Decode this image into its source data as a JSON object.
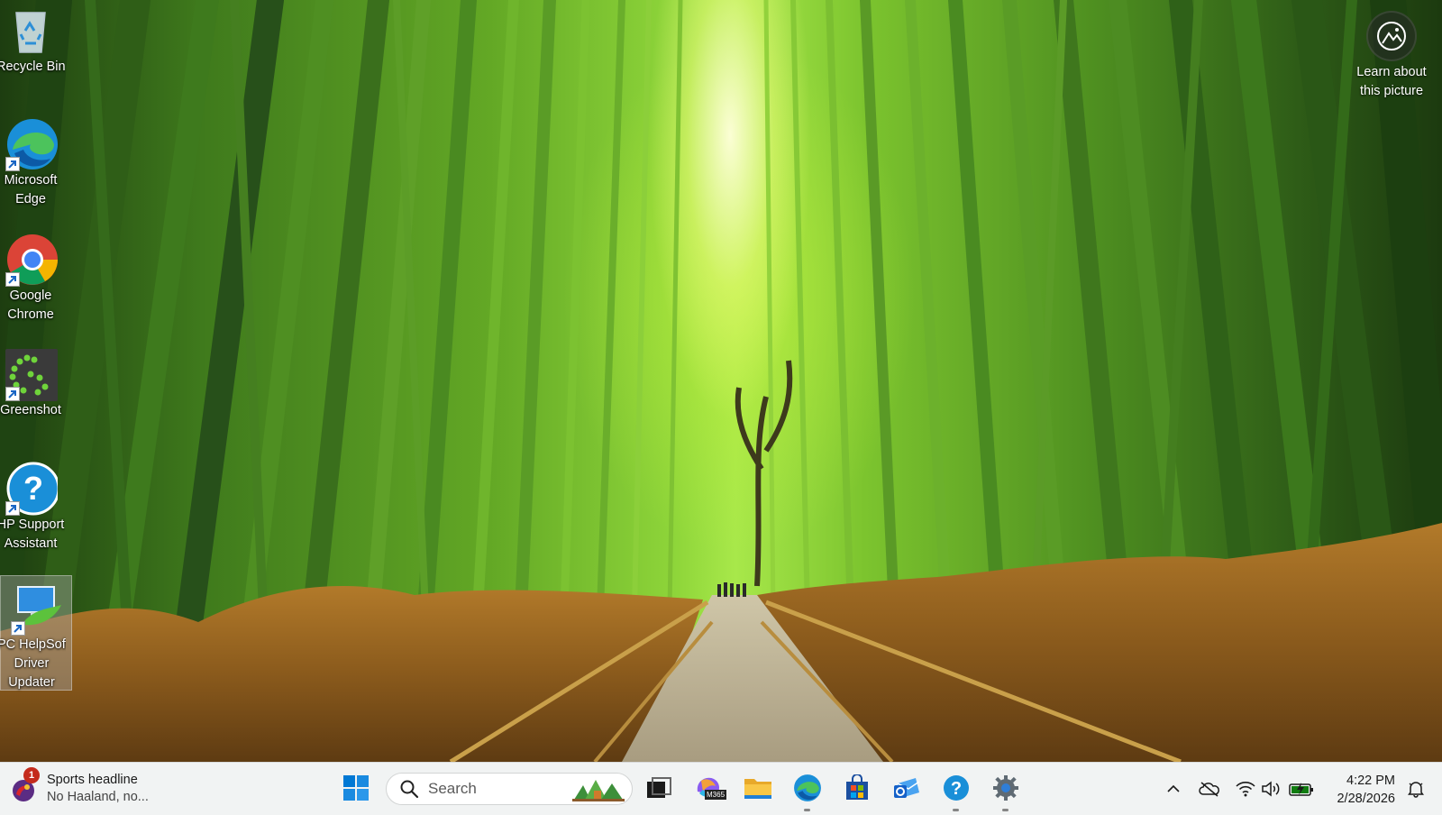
{
  "desktop": {
    "icons": [
      {
        "label": "Recycle Bin",
        "icon": "recycle-bin-icon"
      },
      {
        "label": "Microsoft Edge",
        "icon": "edge-icon"
      },
      {
        "label": "Google Chrome",
        "icon": "chrome-icon"
      },
      {
        "label": "Greenshot",
        "icon": "greenshot-icon"
      },
      {
        "label": "HP Support Assistant",
        "icon": "hp-support-icon"
      },
      {
        "label": "PC HelpSoft Driver Updater",
        "icon": "driver-updater-icon"
      }
    ],
    "icon_lines": {
      "recycle": [
        "Recycle Bin"
      ],
      "edge": [
        "Microsoft",
        "Edge"
      ],
      "chrome": [
        "Google",
        "Chrome"
      ],
      "greenshot": [
        "Greenshot"
      ],
      "hp": [
        "HP Support",
        "Assistant"
      ],
      "driver": [
        "PC HelpSoft",
        "Driver",
        "Updater"
      ]
    },
    "learn_about": {
      "line1": "Learn about",
      "line2": "this picture",
      "icon": "camera-info-icon"
    }
  },
  "taskbar": {
    "widget": {
      "badge": "1",
      "headline": "Sports headline",
      "subtext": "No Haaland, no..."
    },
    "search": {
      "placeholder": "Search"
    },
    "pinned": [
      "Start",
      "Task View",
      "Microsoft 365",
      "File Explorer",
      "Microsoft Edge",
      "Microsoft Store",
      "Outlook",
      "HP Support Assistant",
      "Settings"
    ],
    "m365_label": "M365",
    "tray": [
      "chevron-up-icon",
      "onedrive-offline-icon",
      "wifi-icon",
      "volume-icon",
      "battery-charging-icon"
    ],
    "clock": {
      "time": "4:22 PM",
      "date": "2/28/2026"
    }
  },
  "colors": {
    "taskbar_bg": "#f1f3f3",
    "windows_blue": "#0078d4",
    "badge_red": "#c42b1c"
  }
}
